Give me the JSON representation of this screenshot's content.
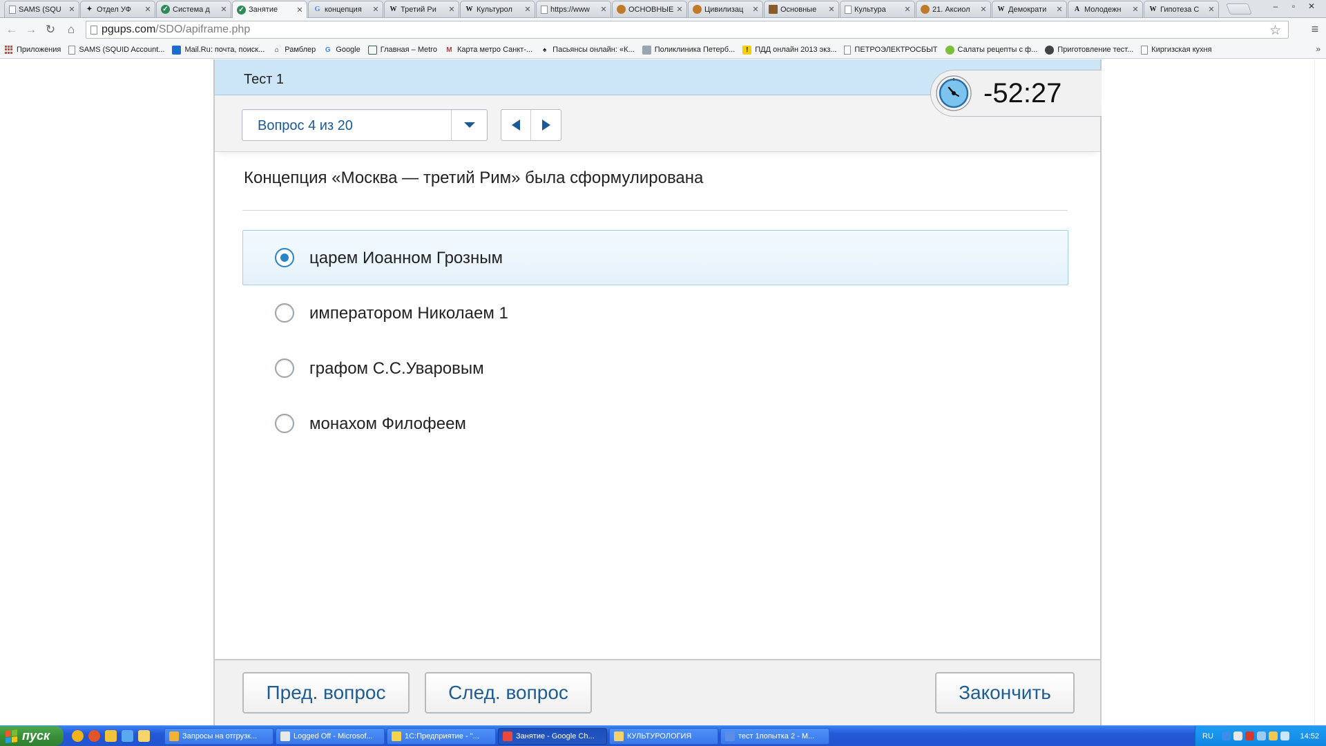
{
  "browser": {
    "tabs": [
      {
        "title": "SAMS (SQU",
        "icon": "doc-icon",
        "active": false
      },
      {
        "title": "Отдел УФ",
        "icon": "star-icon",
        "active": false
      },
      {
        "title": "Система д",
        "icon": "sdo-icon",
        "active": false
      },
      {
        "title": "Занятие",
        "icon": "sdo-icon",
        "active": true
      },
      {
        "title": "концепция",
        "icon": "google-icon",
        "active": false
      },
      {
        "title": "Третий Ри",
        "icon": "wikipedia-icon",
        "active": false
      },
      {
        "title": "Культурол",
        "icon": "wikipedia-icon",
        "active": false
      },
      {
        "title": "https://www",
        "icon": "doc-icon",
        "active": false
      },
      {
        "title": "ОСНОВНЫЕ",
        "icon": "site-icon",
        "active": false
      },
      {
        "title": "Цивилизац",
        "icon": "site-icon",
        "active": false
      },
      {
        "title": "Основные",
        "icon": "book-icon",
        "active": false
      },
      {
        "title": "Культура",
        "icon": "doc-icon",
        "active": false
      },
      {
        "title": "21. Аксиол",
        "icon": "site-icon",
        "active": false
      },
      {
        "title": "Демократи",
        "icon": "wikipedia-icon",
        "active": false
      },
      {
        "title": "Молодежн",
        "icon": "a-icon",
        "active": false
      },
      {
        "title": "Гипотеза С",
        "icon": "wikipedia-icon",
        "active": false
      }
    ],
    "window_controls": [
      "–",
      "▫",
      "✕"
    ],
    "address": {
      "host": "pgups.com",
      "path": "/SDO/apiframe.php"
    },
    "bookmarks": [
      {
        "label": "Приложения",
        "icon": "apps-icon"
      },
      {
        "label": "SAMS (SQUID Account...",
        "icon": "doc-icon"
      },
      {
        "label": "Mail.Ru: почта, поиск...",
        "icon": "mail-icon"
      },
      {
        "label": "Рамблер",
        "icon": "home-icon"
      },
      {
        "label": "Google",
        "icon": "google-icon"
      },
      {
        "label": "Главная – Metro",
        "icon": "metro-icon"
      },
      {
        "label": "Карта метро Санкт-...",
        "icon": "metro-map-icon"
      },
      {
        "label": "Пасьянсы онлайн: «К...",
        "icon": "spade-icon"
      },
      {
        "label": "Поликлиника Петерб...",
        "icon": "clinic-icon"
      },
      {
        "label": "ПДД онлайн 2013 экз...",
        "icon": "warning-icon"
      },
      {
        "label": "ПЕТРОЭЛЕКТРОСБЫТ",
        "icon": "doc-icon"
      },
      {
        "label": "Салаты рецепты с ф...",
        "icon": "salad-icon"
      },
      {
        "label": "Приготовление тест...",
        "icon": "recipe-icon"
      },
      {
        "label": "Киргизская кухня",
        "icon": "doc-icon"
      }
    ],
    "bookmarks_more": "»"
  },
  "test": {
    "title": "Тест 1",
    "timer": "-52:27",
    "question_selector": "Вопрос 4 из 20",
    "question": "Концепция «Москва — третий Рим» была сформулирована",
    "answers": [
      {
        "text": "царем Иоанном Грозным",
        "selected": true
      },
      {
        "text": "императором Николаем 1",
        "selected": false
      },
      {
        "text": "графом С.С.Уваровым",
        "selected": false
      },
      {
        "text": "монахом Филофеем",
        "selected": false
      }
    ],
    "buttons": {
      "prev": "Пред. вопрос",
      "next": "След. вопрос",
      "finish": "Закончить"
    },
    "colors": {
      "accent": "#2a84c8",
      "header": "#cce6f7",
      "link_text": "#1f5d96"
    }
  },
  "taskbar": {
    "start_label": "пуск",
    "tasks": [
      {
        "label": "Запросы на отгрузк...",
        "active": false,
        "color": "#f2b233"
      },
      {
        "label": "Logged Off - Microsof...",
        "active": false,
        "color": "#e8e8e8"
      },
      {
        "label": "1С:Предприятие - \"...",
        "active": false,
        "color": "#f5d34a"
      },
      {
        "label": "Занятие - Google Ch...",
        "active": true,
        "color": "#e9483b"
      },
      {
        "label": "КУЛЬТУРОЛОГИЯ",
        "active": false,
        "color": "#f4d36a"
      },
      {
        "label": "тест 1попытка 2 - М...",
        "active": false,
        "color": "#5b8ee6"
      }
    ],
    "language": "RU",
    "clock": "14:52"
  }
}
